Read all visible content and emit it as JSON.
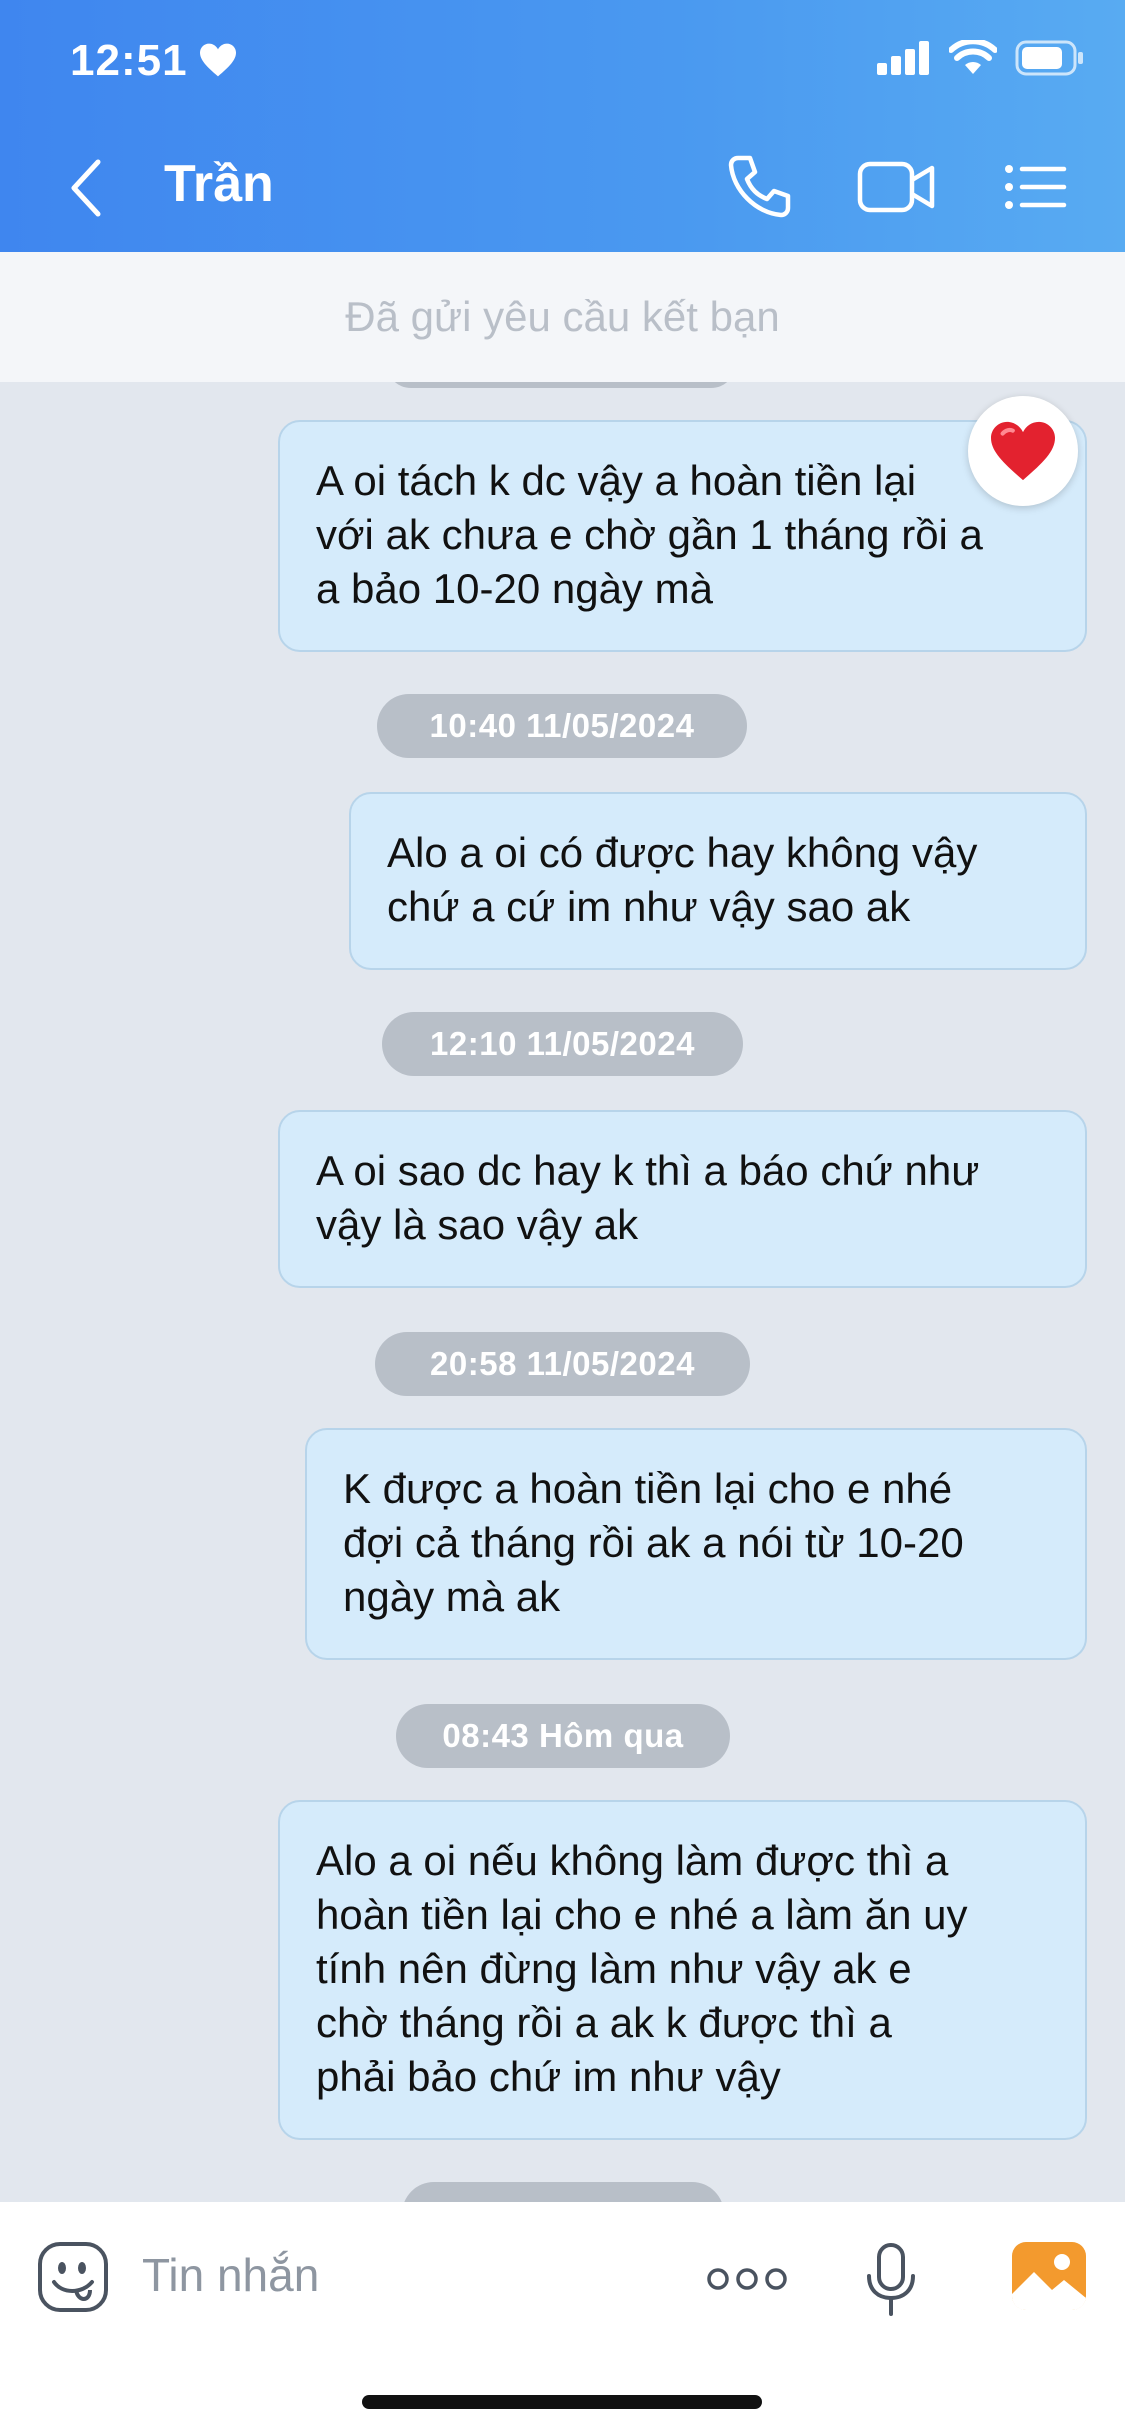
{
  "status": {
    "time": "12:51"
  },
  "header": {
    "title": "Trần"
  },
  "friend_request": {
    "text": "Đã gửi yêu cầu kết bạn"
  },
  "messages": [
    {
      "text": "A oi tách k dc vậy a hoàn tiền lại\nvới ak chưa e chờ gần 1 tháng rồi a\na bảo 10-20 ngày mà",
      "reaction": "heart"
    },
    {
      "timestamp": "10:40 11/05/2024"
    },
    {
      "text": "Alo a oi có được hay không vậy\nchứ a cứ im như vậy sao ak"
    },
    {
      "timestamp": "12:10 11/05/2024"
    },
    {
      "text": "A oi sao dc hay k thì a báo chứ như\nvậy là sao vậy ak"
    },
    {
      "timestamp": "20:58 11/05/2024"
    },
    {
      "text": "K được a hoàn tiền lại cho e nhé\nđợi cả tháng rồi ak a nói từ 10-20\nngày mà ak"
    },
    {
      "timestamp": "08:43 Hôm qua"
    },
    {
      "text": "Alo a oi nếu không làm được thì a\nhoàn tiền lại cho e nhé a làm ăn uy\ntính nên đừng làm như vậy ak e\nchờ tháng rồi a ak k được thì a\nphải bảo chứ im như vậy"
    }
  ],
  "composer": {
    "placeholder": "Tin nhắn"
  },
  "colors": {
    "header": "#4a94f0",
    "bubble": "#d5ebfb",
    "background": "#e2e7ee",
    "stamp": "#b8bfc8"
  }
}
